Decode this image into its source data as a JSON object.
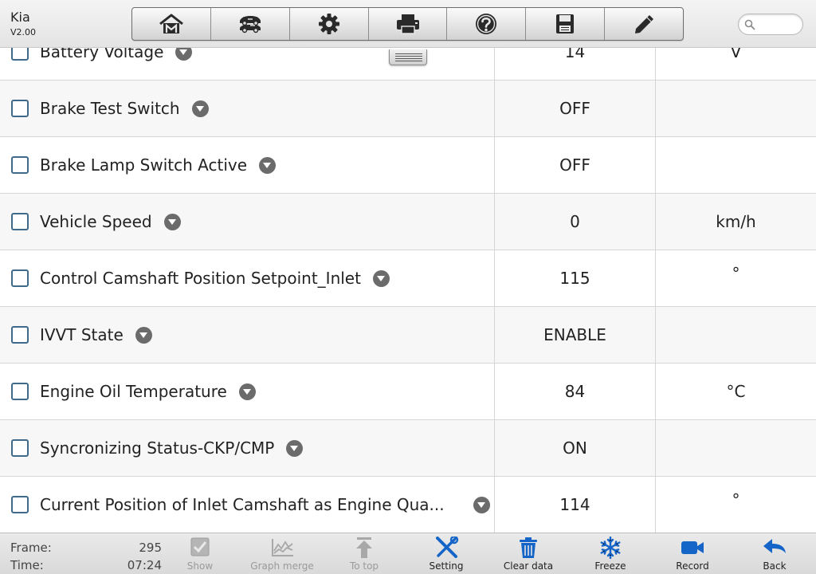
{
  "header": {
    "make": "Kia",
    "version": "V2.00",
    "toolbar": [
      {
        "name": "home-icon"
      },
      {
        "name": "vehicle-swap-icon"
      },
      {
        "name": "gear-icon"
      },
      {
        "name": "printer-icon"
      },
      {
        "name": "help-icon"
      },
      {
        "name": "save-icon"
      },
      {
        "name": "pencil-icon"
      }
    ],
    "search": {
      "value": "",
      "placeholder": ""
    }
  },
  "table": {
    "rows": [
      {
        "name": "Battery Voltage",
        "value": "14",
        "unit": "V"
      },
      {
        "name": "Brake Test Switch",
        "value": "OFF",
        "unit": ""
      },
      {
        "name": "Brake Lamp Switch Active",
        "value": "OFF",
        "unit": ""
      },
      {
        "name": "Vehicle Speed",
        "value": "0",
        "unit": "km/h"
      },
      {
        "name": "Control Camshaft Position Setpoint_Inlet",
        "value": "115",
        "unit": "°"
      },
      {
        "name": "IVVT State",
        "value": "ENABLE",
        "unit": ""
      },
      {
        "name": "Engine Oil Temperature",
        "value": "84",
        "unit": "°C"
      },
      {
        "name": "Syncronizing Status-CKP/CMP",
        "value": "ON",
        "unit": ""
      },
      {
        "name": "Current Position of Inlet Camshaft as Engine Qua...",
        "value": "114",
        "unit": "°"
      }
    ]
  },
  "footer": {
    "frame_label": "Frame:",
    "frame_value": "295",
    "time_label": "Time:",
    "time_value": "07:24",
    "actions": [
      {
        "label": "Show",
        "icon": "checkbox-icon",
        "enabled": false
      },
      {
        "label": "Graph merge",
        "icon": "graph-icon",
        "enabled": false
      },
      {
        "label": "To top",
        "icon": "arrow-up-icon",
        "enabled": false
      },
      {
        "label": "Setting",
        "icon": "tools-icon",
        "enabled": true
      },
      {
        "label": "Clear data",
        "icon": "trash-icon",
        "enabled": true
      },
      {
        "label": "Freeze",
        "icon": "snowflake-icon",
        "enabled": true
      },
      {
        "label": "Record",
        "icon": "video-camera-icon",
        "enabled": true
      },
      {
        "label": "Back",
        "icon": "back-arrow-icon",
        "enabled": true
      }
    ]
  },
  "colors": {
    "accent_blue": "#1565c8",
    "disabled_gray": "#a8a8a8",
    "caret_gray": "#6b6b6b"
  }
}
